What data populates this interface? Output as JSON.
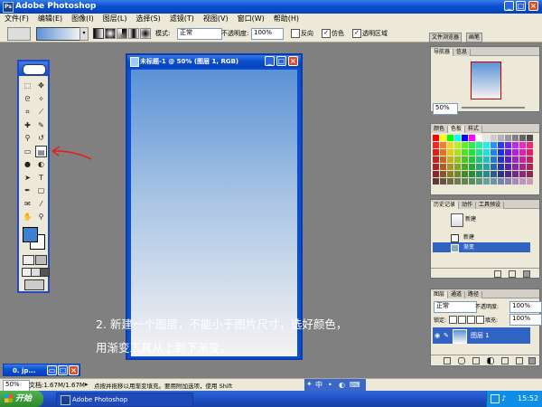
{
  "window": {
    "title": "Adobe Photoshop"
  },
  "menu": [
    "文件(F)",
    "编辑(E)",
    "图像(I)",
    "图层(L)",
    "选择(S)",
    "滤镜(T)",
    "视图(V)",
    "窗口(W)",
    "帮助(H)"
  ],
  "options": {
    "mode_label": "模式:",
    "mode_value": "正常",
    "opacity_label": "不透明度:",
    "opacity_value": "100%",
    "reverse_label": "反向",
    "dither_label": "仿色",
    "transparency_label": "透明区域",
    "tabs": [
      "文件浏览器",
      "画笔"
    ]
  },
  "document": {
    "title": "未标题-1 @ 50% (图层 1, RGB)"
  },
  "navigator": {
    "tabs": [
      "导航器",
      "信息"
    ],
    "zoom": "50%"
  },
  "color_panel": {
    "tabs": [
      "颜色",
      "色板",
      "样式"
    ]
  },
  "history": {
    "tabs": [
      "历史记录",
      "动作",
      "工具预设"
    ],
    "snapshot": "新建",
    "steps": [
      "新建",
      "渐变"
    ]
  },
  "layers": {
    "tabs": [
      "图层",
      "通道",
      "路径"
    ],
    "blend": "正常",
    "opacity_label": "不透明度:",
    "opacity": "100%",
    "lock_label": "锁定:",
    "fill_label": "填充:",
    "fill": "100%",
    "layer_name": "图层 1"
  },
  "annotation": {
    "line1": "2. 新建一个图层，不能小于图片尺寸，选好颜色，",
    "line2": "用渐变工具从上到下渐变。"
  },
  "minimized_doc": {
    "title": "0. jp..."
  },
  "status": {
    "zoom": "50%",
    "doc_size": "文档:1.67M/1.67M",
    "hint": "点按并拖移以用渐变填充。要用附加选项，使用 Shift"
  },
  "ime": {
    "mode": "中"
  },
  "taskbar": {
    "start": "开始",
    "app": "Adobe Photoshop",
    "time": "15:52"
  },
  "colors": {
    "gradient_top": "#5b92d6",
    "gradient_bottom": "#f5f3f3",
    "foreground": "#3d80d0"
  }
}
